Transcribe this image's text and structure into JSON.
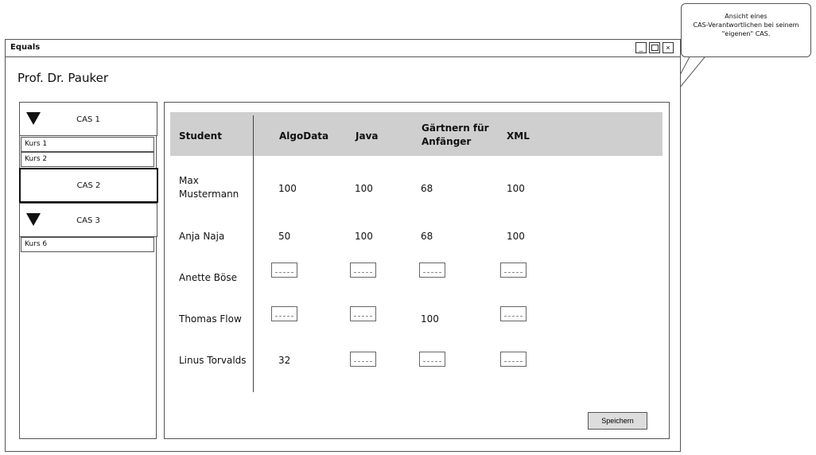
{
  "annotation": {
    "line1": "Ansicht eines",
    "line2": "CAS-Verantwortlichen bei seinem",
    "line3": "\"eigenen\" CAS."
  },
  "window": {
    "title": "Equals",
    "minimize_glyph": "_",
    "close_glyph": "×"
  },
  "user": {
    "name": "Prof. Dr. Pauker"
  },
  "sidebar": {
    "cas1": {
      "label": "CAS 1",
      "kurse": [
        "Kurs 1",
        "Kurs 2"
      ]
    },
    "cas2": {
      "label": "CAS 2"
    },
    "cas3": {
      "label": "CAS 3",
      "kurse": [
        "Kurs 6"
      ]
    }
  },
  "table": {
    "headers": {
      "student": "Student",
      "c1": "AlgoData",
      "c2": "Java",
      "c3_line1": "Gärtnern für",
      "c3_line2": "Anfänger",
      "c4": "XML"
    },
    "rows": [
      {
        "name_line1": "Max",
        "name_line2": "Mustermann",
        "algodata": "100",
        "java": "100",
        "gaertnern": "68",
        "xml": "100"
      },
      {
        "name": "Anja Naja",
        "algodata": "50",
        "java": "100",
        "gaertnern": "68",
        "xml": "100"
      },
      {
        "name": "Anette Böse"
      },
      {
        "name": "Thomas Flow",
        "gaertnern": "100"
      },
      {
        "name": "Linus Torvalds",
        "algodata": "32"
      }
    ]
  },
  "actions": {
    "save_label": "Speichern"
  }
}
